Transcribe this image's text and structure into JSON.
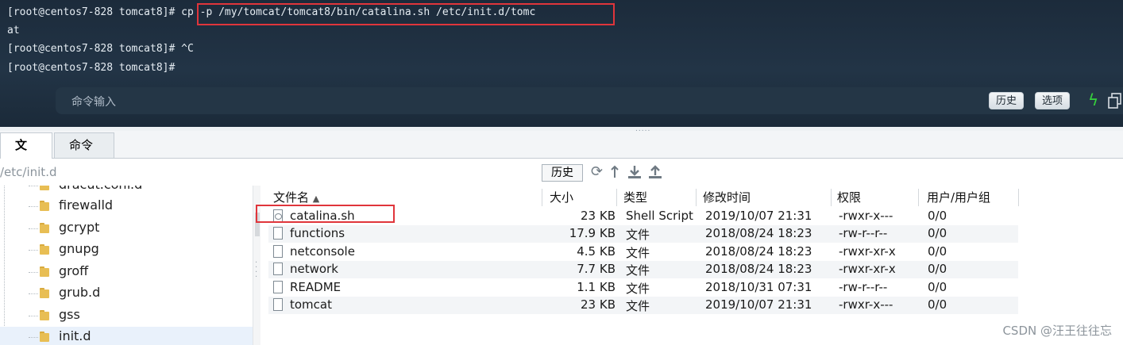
{
  "terminal": {
    "lines": [
      "[root@centos7-828 tomcat8]# cp -p /my/tomcat/tomcat8/bin/catalina.sh /etc/init.d/tomc",
      "at",
      "[root@centos7-828 tomcat8]# ^C",
      "[root@centos7-828 tomcat8]#"
    ],
    "command_placeholder": "命令输入",
    "history_label": "历史",
    "options_label": "选项",
    "bolt_glyph": "ϟ"
  },
  "tabs": {
    "file_label": "文件",
    "command_label": "命令"
  },
  "path": {
    "value": "/etc/init.d",
    "history_label": "历史"
  },
  "tree": {
    "items": [
      "dracut.conf.d",
      "firewalld",
      "gcrypt",
      "gnupg",
      "groff",
      "grub.d",
      "gss",
      "init.d"
    ]
  },
  "file_list": {
    "headers": {
      "name": "文件名",
      "size": "大小",
      "type": "类型",
      "modified": "修改时间",
      "perm": "权限",
      "owner": "用户/用户组"
    },
    "sort_arrow": "▲",
    "rows": [
      {
        "name": "catalina.sh",
        "size": "23 KB",
        "type": "Shell Script",
        "modified": "2019/10/07 21:31",
        "perm": "-rwxr-x---",
        "owner": "0/0"
      },
      {
        "name": "functions",
        "size": "17.9 KB",
        "type": "文件",
        "modified": "2018/08/24 18:23",
        "perm": "-rw-r--r--",
        "owner": "0/0"
      },
      {
        "name": "netconsole",
        "size": "4.5 KB",
        "type": "文件",
        "modified": "2018/08/24 18:23",
        "perm": "-rwxr-xr-x",
        "owner": "0/0"
      },
      {
        "name": "network",
        "size": "7.7 KB",
        "type": "文件",
        "modified": "2018/08/24 18:23",
        "perm": "-rwxr-xr-x",
        "owner": "0/0"
      },
      {
        "name": "README",
        "size": "1.1 KB",
        "type": "文件",
        "modified": "2018/10/31 07:31",
        "perm": "-rw-r--r--",
        "owner": "0/0"
      },
      {
        "name": "tomcat",
        "size": "23 KB",
        "type": "文件",
        "modified": "2019/10/07 21:31",
        "perm": "-rwxr-x---",
        "owner": "0/0"
      }
    ]
  },
  "watermark": "CSDN @汪王往往忘"
}
